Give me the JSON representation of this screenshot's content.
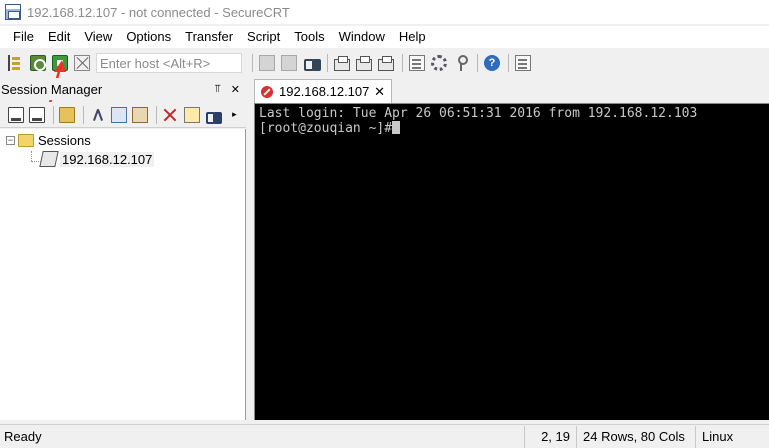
{
  "window": {
    "title": "192.168.12.107 - not connected - SecureCRT"
  },
  "menu": {
    "items": [
      "File",
      "Edit",
      "View",
      "Options",
      "Transfer",
      "Script",
      "Tools",
      "Window",
      "Help"
    ]
  },
  "toolbar": {
    "quick_connect_placeholder": "Enter host <Alt+R>"
  },
  "session_manager": {
    "title": "Session Manager",
    "pin_glyph": "⫪",
    "close_glyph": "✕",
    "more_glyph": "▸",
    "tree": {
      "root_expander": "−",
      "root_label": "Sessions",
      "children": [
        {
          "label": "192.168.12.107"
        }
      ]
    }
  },
  "tabs": [
    {
      "label": "192.168.12.107",
      "close_glyph": "✕",
      "status_color": "#d93030"
    }
  ],
  "terminal": {
    "lines": [
      "Last login: Tue Apr 26 06:51:31 2016 from 192.168.12.103",
      "[root@zouqian ~]#"
    ],
    "background": "#000000",
    "foreground": "#c8c8c8"
  },
  "statusbar": {
    "ready": "Ready",
    "cursor_pos": "2,  19",
    "dimensions": "24 Rows, 80 Cols",
    "os": "Linux"
  },
  "colors": {
    "annotation_arrow": "#e8322a",
    "help_blue": "#2f6cc0"
  }
}
